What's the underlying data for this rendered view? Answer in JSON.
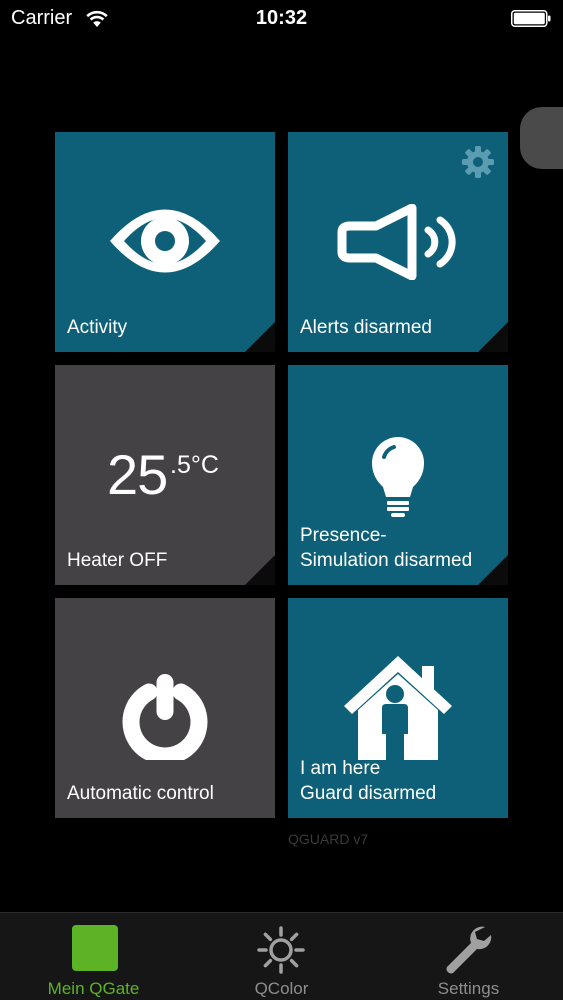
{
  "status_bar": {
    "carrier": "Carrier",
    "time": "10:32"
  },
  "tiles": {
    "activity": {
      "label": "Activity",
      "icon": "eye-icon"
    },
    "alerts": {
      "label": "Alerts disarmed",
      "icon": "speaker-icon"
    },
    "heater": {
      "temp_main": "25",
      "temp_decimal": ".5°C",
      "label": "Heater OFF"
    },
    "presence": {
      "label_line1": "Presence-",
      "label_line2": "Simulation disarmed",
      "icon": "lightbulb-icon"
    },
    "auto": {
      "label": "Automatic control",
      "icon": "power-icon"
    },
    "guard": {
      "label_line1": "I am here",
      "label_line2": "Guard disarmed",
      "icon": "house-person-icon"
    }
  },
  "version": "QGUARD v7",
  "tab_bar": {
    "items": [
      {
        "label": "Mein QGate",
        "icon": "square-icon",
        "active": true
      },
      {
        "label": "QColor",
        "icon": "sun-icon",
        "active": false
      },
      {
        "label": "Settings",
        "icon": "wrench-icon",
        "active": false
      }
    ]
  },
  "colors": {
    "tile_blue": "#0e6079",
    "tile_gray": "#444245",
    "accent_green": "#5cb325",
    "background": "#000000"
  }
}
